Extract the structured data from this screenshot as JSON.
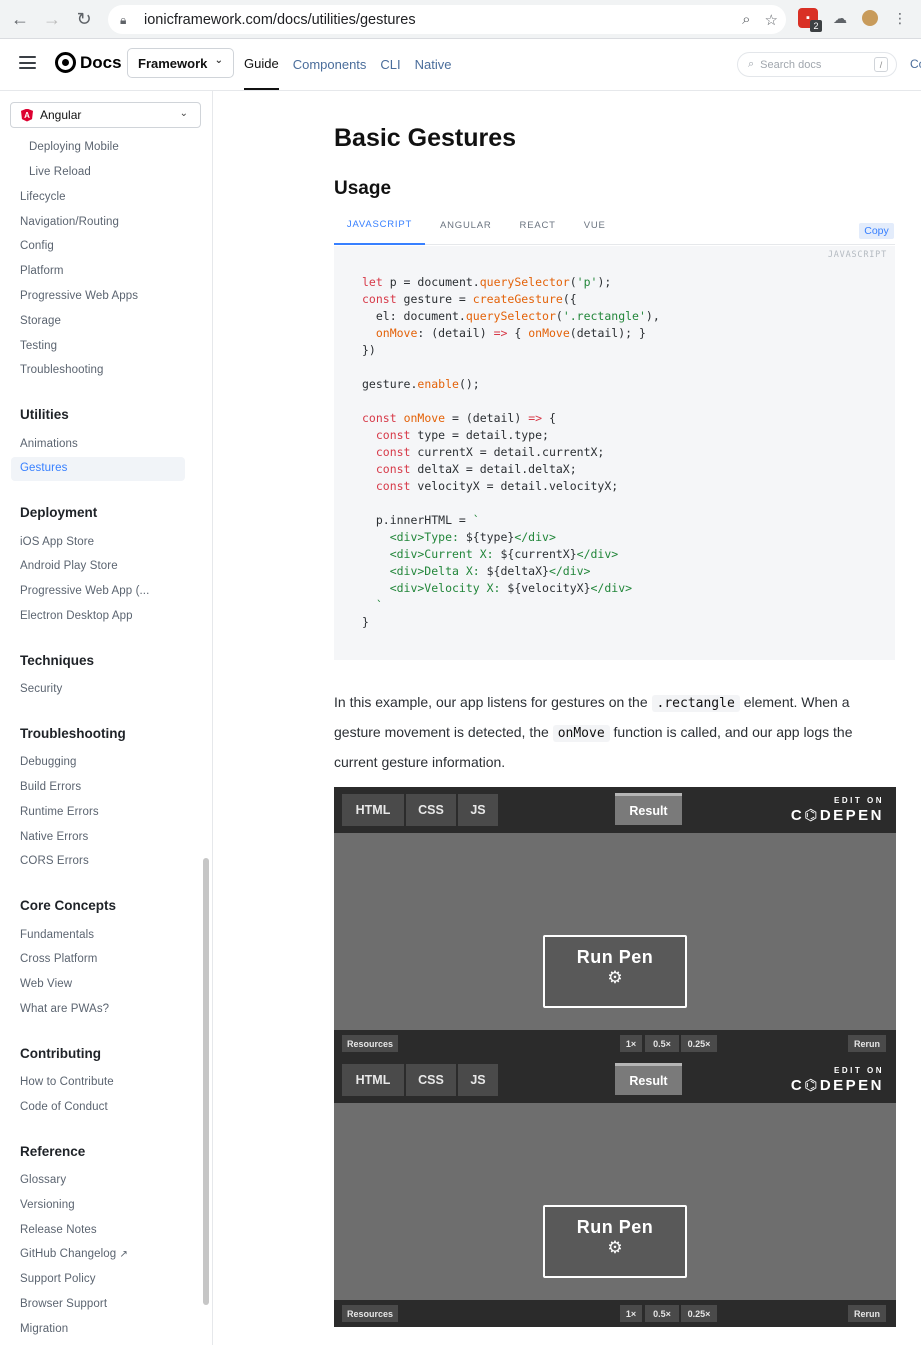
{
  "browser": {
    "url": "ionicframework.com/docs/utilities/gestures",
    "ext_badge": "2"
  },
  "navbar": {
    "logo": "Docs",
    "framework": "Framework",
    "links": [
      "Guide",
      "Components",
      "CLI",
      "Native"
    ],
    "active_link": "Guide",
    "search_placeholder": "Search docs",
    "search_shortcut": "/",
    "cut_text": "Co"
  },
  "sidebar": {
    "framework_select": "Angular",
    "items_top": [
      "Deploying Mobile",
      "Live Reload"
    ],
    "items_main": [
      "Lifecycle",
      "Navigation/Routing",
      "Config",
      "Platform",
      "Progressive Web Apps",
      "Storage",
      "Testing",
      "Troubleshooting"
    ],
    "sections": [
      {
        "title": "Utilities",
        "items": [
          "Animations",
          "Gestures"
        ]
      },
      {
        "title": "Deployment",
        "items": [
          "iOS App Store",
          "Android Play Store",
          "Progressive Web App (...",
          "Electron Desktop App"
        ]
      },
      {
        "title": "Techniques",
        "items": [
          "Security"
        ]
      },
      {
        "title": "Troubleshooting",
        "items": [
          "Debugging",
          "Build Errors",
          "Runtime Errors",
          "Native Errors",
          "CORS Errors"
        ]
      },
      {
        "title": "Core Concepts",
        "items": [
          "Fundamentals",
          "Cross Platform",
          "Web View",
          "What are PWAs?"
        ]
      },
      {
        "title": "Contributing",
        "items": [
          "How to Contribute",
          "Code of Conduct"
        ]
      },
      {
        "title": "Reference",
        "items": [
          "Glossary",
          "Versioning",
          "Release Notes",
          "GitHub Changelog",
          "Support Policy",
          "Browser Support",
          "Migration"
        ]
      }
    ],
    "active_item": "Gestures"
  },
  "main": {
    "title": "Basic Gestures",
    "subtitle": "Usage",
    "tabs": [
      "JAVASCRIPT",
      "ANGULAR",
      "REACT",
      "VUE"
    ],
    "active_tab": "JAVASCRIPT",
    "copy_label": "Copy",
    "code_lang": "JAVASCRIPT",
    "para_1": "In this example, our app listens for gestures on the",
    "para_code_1": ".rectangle",
    "para_2": "element. When a gesture movement is detected, the",
    "para_code_2": "onMove",
    "para_3": "function is called, and our app logs the current gesture information."
  },
  "pen": {
    "tabs": [
      "HTML",
      "CSS",
      "JS"
    ],
    "result": "Result",
    "edit_on": "EDIT ON",
    "codepen": "C⌬DEPEN",
    "run": "Run Pen",
    "resources": "Resources",
    "zooms": [
      "1×",
      "0.5×",
      "0.25×"
    ],
    "rerun": "Rerun"
  }
}
